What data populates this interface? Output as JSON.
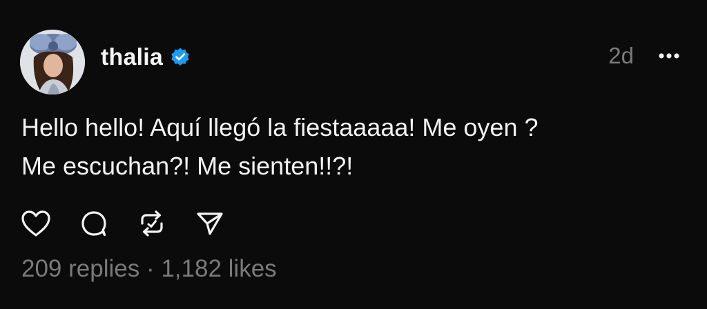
{
  "post": {
    "author": {
      "username": "thalia",
      "verified": true,
      "avatar_icon": "profile-photo"
    },
    "time": "2d",
    "menu_icon": "more-icon",
    "text_lines": [
      "Hello hello! Aquí llegó la fiestaaaaa! Me oyen ?",
      "Me escuchan?! Me sienten!!?!"
    ],
    "actions": [
      {
        "icon": "heart-icon",
        "label": "Like"
      },
      {
        "icon": "comment-icon",
        "label": "Reply"
      },
      {
        "icon": "repost-icon",
        "label": "Repost"
      },
      {
        "icon": "send-icon",
        "label": "Share"
      }
    ],
    "stats": {
      "replies": "209 replies",
      "separator": " · ",
      "likes": "1,182 likes"
    }
  },
  "colors": {
    "background": "#0b0b0b",
    "text": "#f3f3f3",
    "muted": "#7a7a7a",
    "verified": "#1d9bf0"
  }
}
